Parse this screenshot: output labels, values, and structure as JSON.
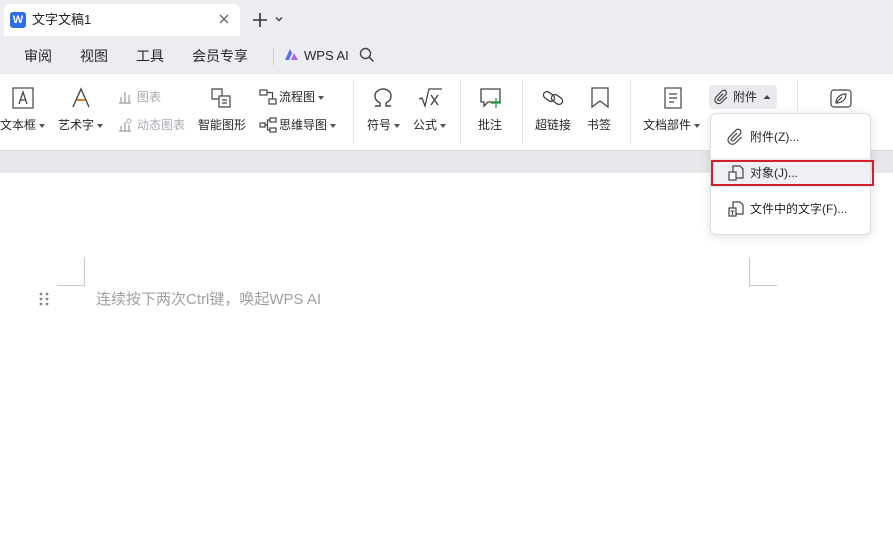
{
  "titlebar": {
    "doc_title": "文字文稿1",
    "logo_letter": "W"
  },
  "menu": {
    "items": [
      "审阅",
      "视图",
      "工具",
      "会员专享"
    ],
    "wps_ai": "WPS AI"
  },
  "ribbon": {
    "textbox": "文本框",
    "wordart": "艺术字",
    "chart": "图表",
    "dynamic_chart": "动态图表",
    "smart_graphic": "智能图形",
    "flowchart": "流程图",
    "mindmap": "思维导图",
    "symbol": "符号",
    "formula": "公式",
    "comment": "批注",
    "hyperlink": "超链接",
    "bookmark": "书签",
    "doc_parts": "文档部件",
    "attachment": "附件"
  },
  "dropdown": {
    "items": [
      {
        "label": "附件(Z)...",
        "icon": "paperclip-icon"
      },
      {
        "label": "对象(J)...",
        "icon": "object-icon"
      },
      {
        "label": "文件中的文字(F)...",
        "icon": "file-text-icon"
      }
    ]
  },
  "document": {
    "placeholder": "连续按下两次Ctrl键，唤起WPS AI"
  },
  "colors": {
    "brand": "#2c6ced",
    "highlight": "#d0212a"
  }
}
